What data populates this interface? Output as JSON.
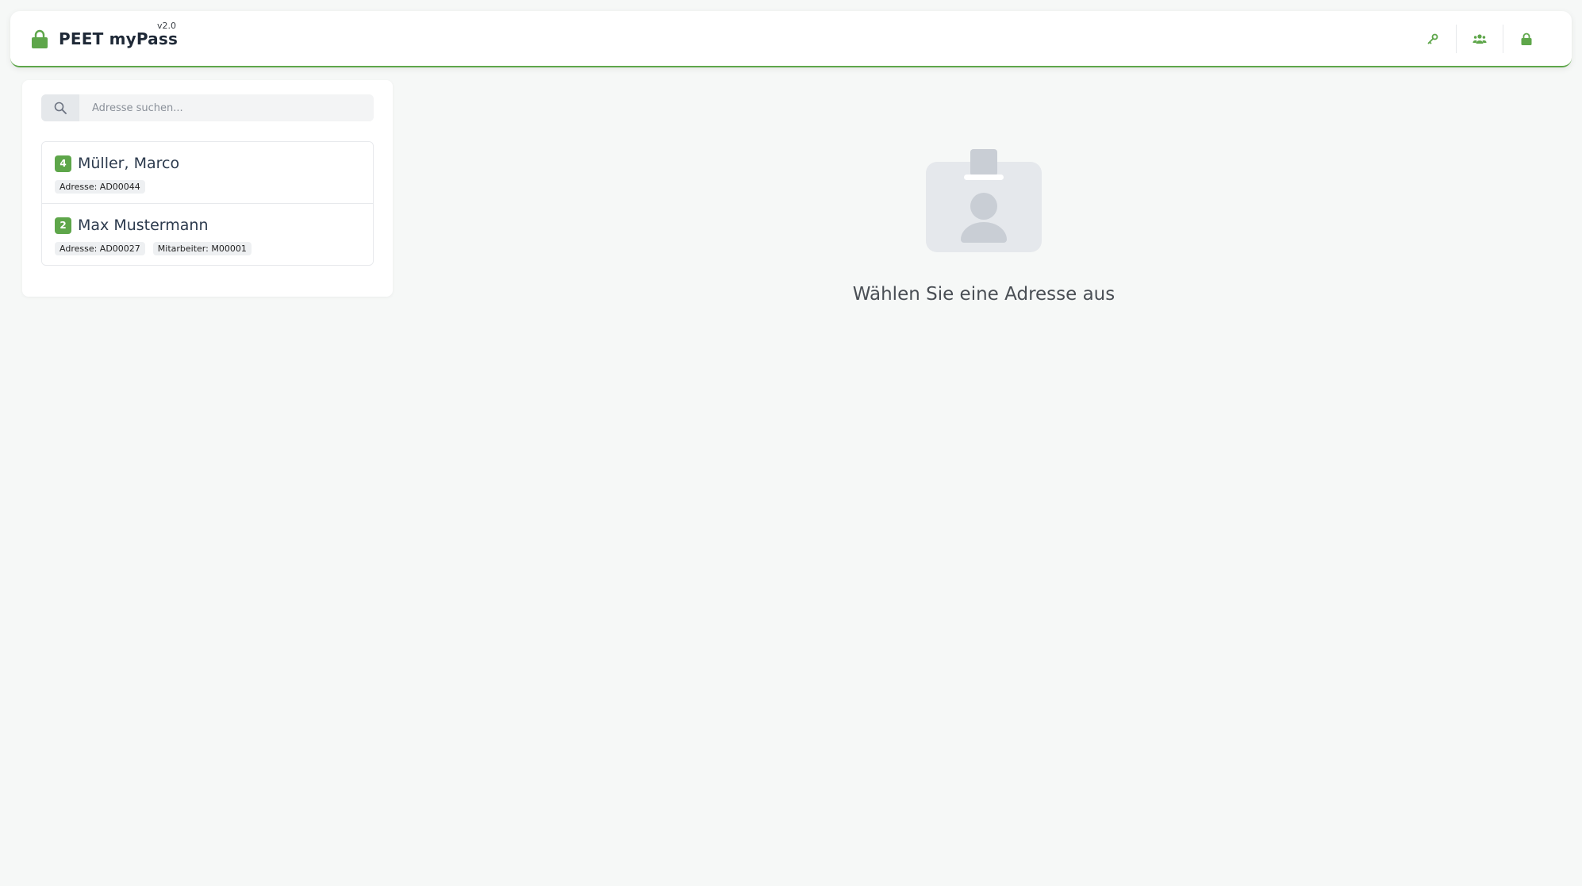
{
  "app": {
    "title": "PEET myPass",
    "version": "v2.0"
  },
  "nav": {
    "actions": [
      {
        "icon": "key-icon"
      },
      {
        "icon": "users-icon"
      },
      {
        "icon": "lock-icon"
      }
    ]
  },
  "search": {
    "placeholder": "Adresse suchen...",
    "value": ""
  },
  "results": [
    {
      "count": "4",
      "name": "Müller, Marco",
      "tags": [
        "Adresse: AD00044"
      ]
    },
    {
      "count": "2",
      "name": "Max Mustermann",
      "tags": [
        "Adresse: AD00027",
        "Mitarbeiter: M00001"
      ]
    }
  ],
  "empty_state": {
    "message": "Wählen Sie eine Adresse aus"
  },
  "colors": {
    "accent": "#5ea64a",
    "placeholder_gray": "#e5e8ec"
  }
}
